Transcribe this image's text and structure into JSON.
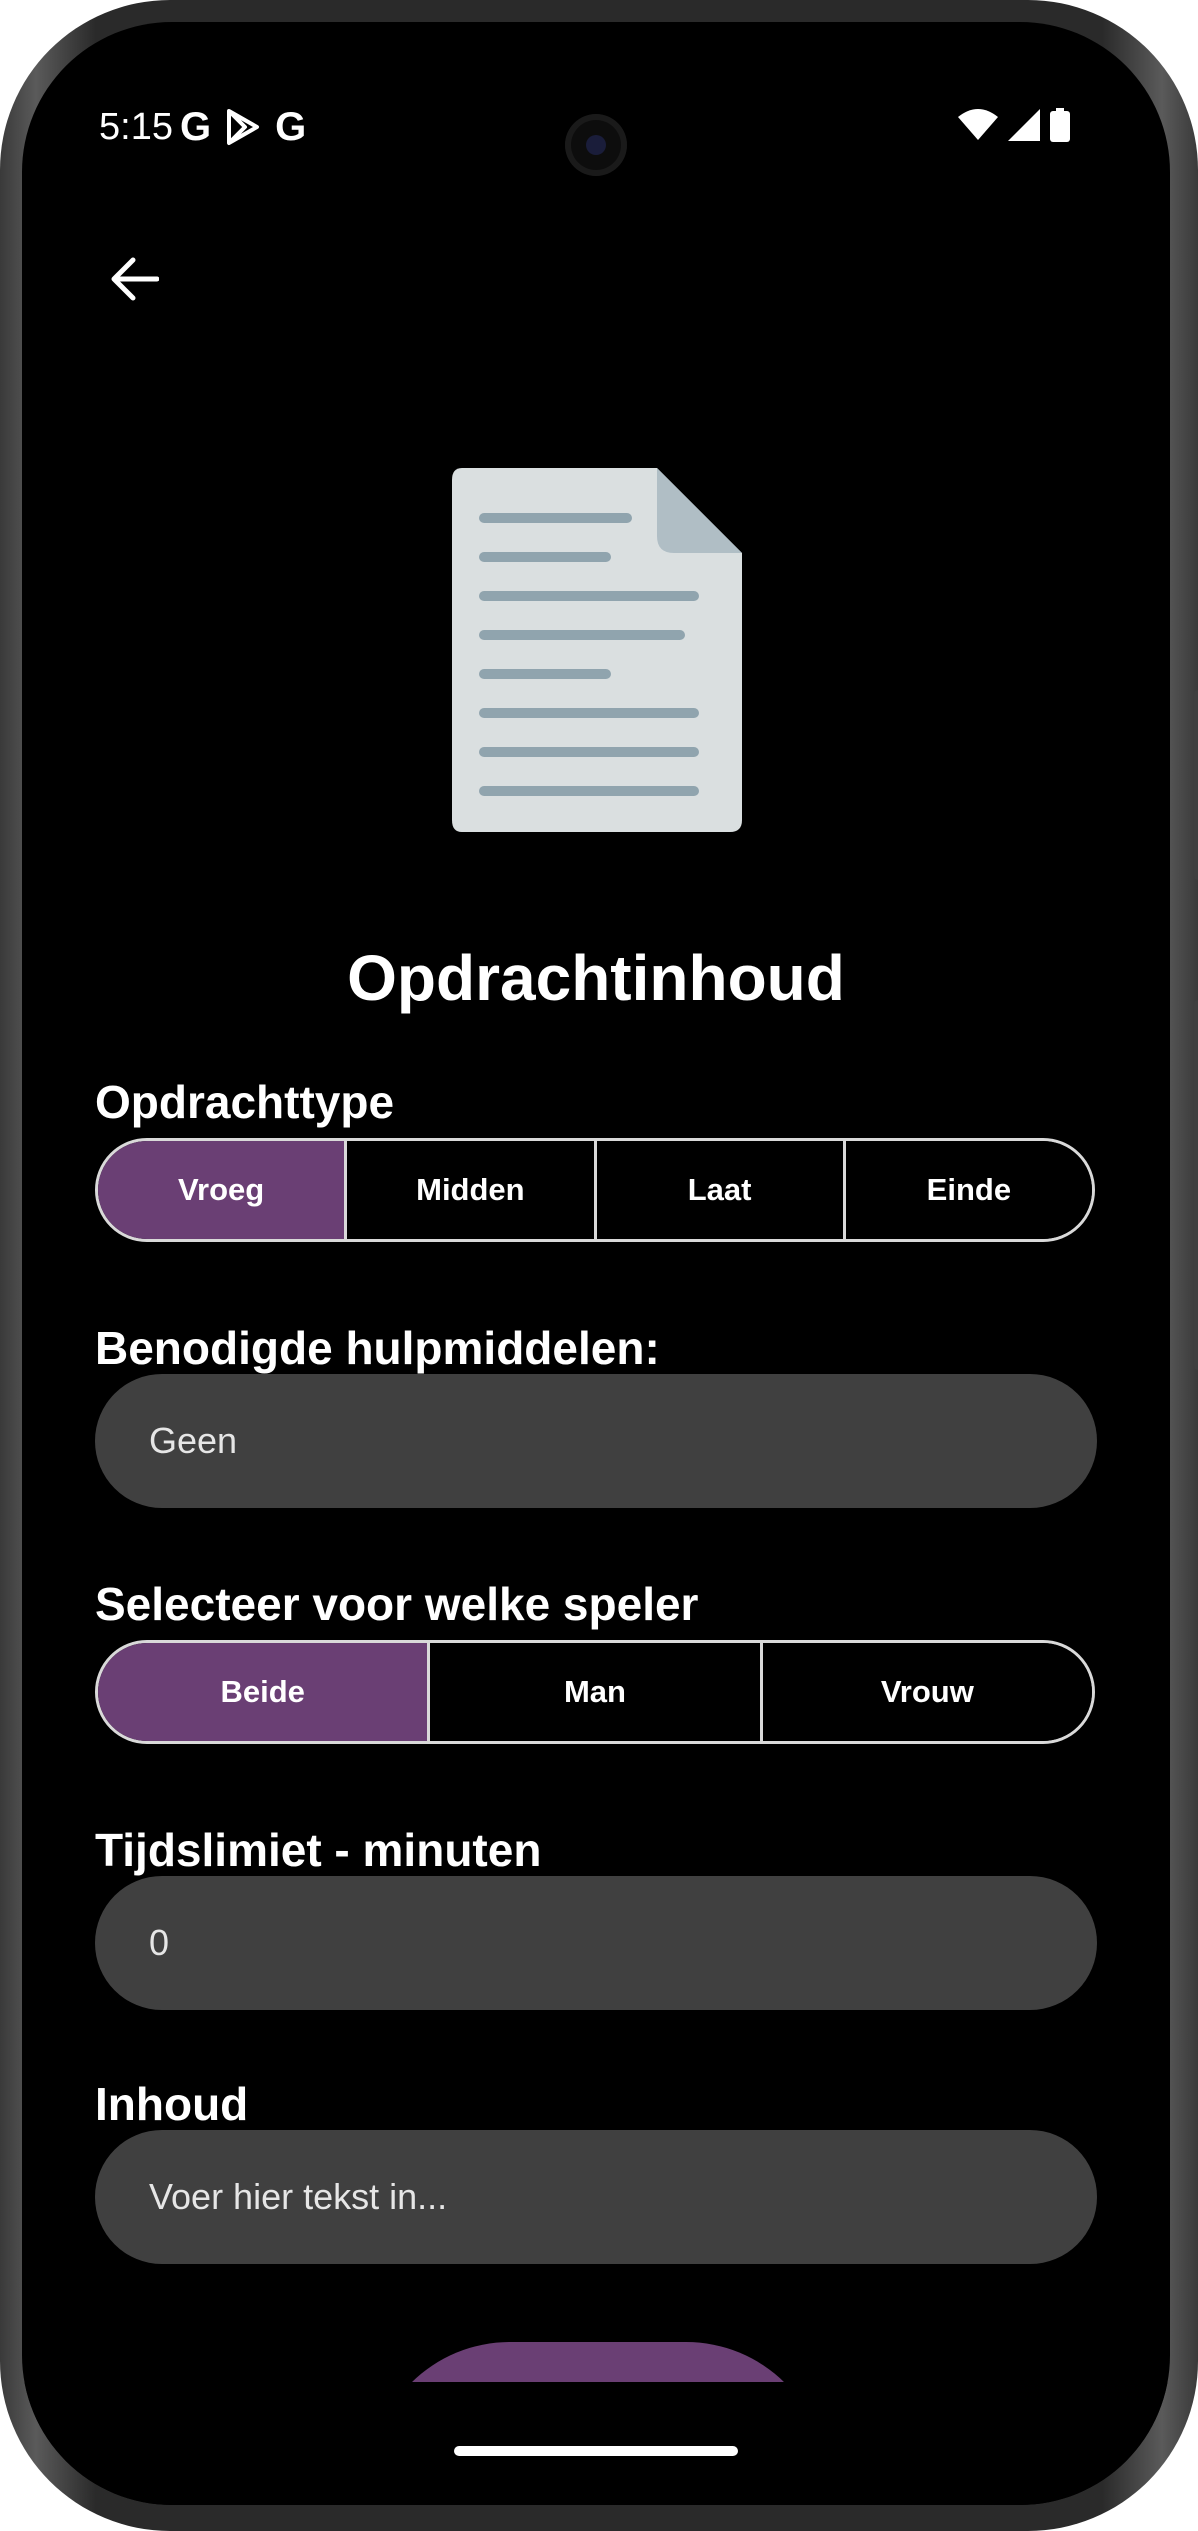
{
  "status_bar": {
    "time": "5:15",
    "left_icons": [
      "google-g-icon",
      "play-store-icon",
      "google-g-icon"
    ],
    "right_icons": [
      "wifi-icon",
      "signal-icon",
      "battery-icon"
    ]
  },
  "header": {
    "back_icon": "arrow-left-icon"
  },
  "hero": {
    "icon": "document-icon",
    "title": "Opdrachtinhoud"
  },
  "assignment_type": {
    "label": "Opdrachttype",
    "options": [
      "Vroeg",
      "Midden",
      "Laat",
      "Einde"
    ],
    "selected": "Vroeg"
  },
  "tools": {
    "label": "Benodigde hulpmiddelen:",
    "value": "Geen"
  },
  "player": {
    "label": "Selecteer voor welke speler",
    "options": [
      "Beide",
      "Man",
      "Vrouw"
    ],
    "selected": "Beide"
  },
  "time_limit": {
    "label": "Tijdslimiet - minuten",
    "value": "0"
  },
  "content": {
    "label": "Inhoud",
    "placeholder": "Voer hier tekst in..."
  },
  "colors": {
    "accent": "#6a3f74",
    "background": "#000000",
    "field": "#404040",
    "document_paper": "#dadfe0",
    "document_lines": "#90a4ae"
  }
}
